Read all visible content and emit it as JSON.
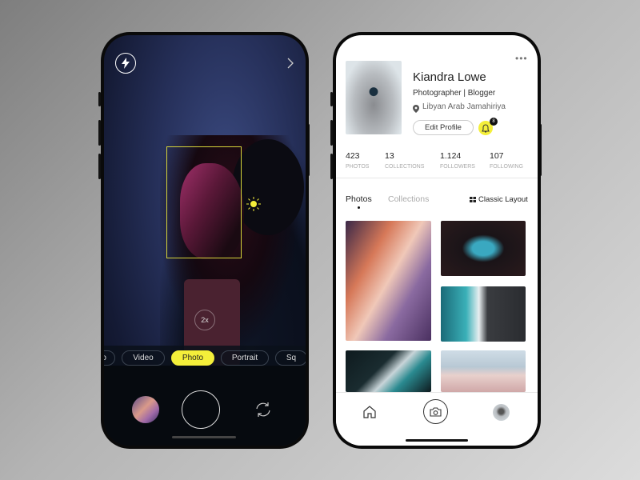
{
  "camera": {
    "zoom_label": "2x",
    "modes": [
      {
        "label": "Mo"
      },
      {
        "label": "Video"
      },
      {
        "label": "Photo",
        "active": true
      },
      {
        "label": "Portrait"
      },
      {
        "label": "Sq"
      }
    ],
    "icons": [
      "flash-icon",
      "chevron-right-icon",
      "sun-exposure-icon",
      "switch-camera-icon"
    ],
    "accent": "#f4ef3a"
  },
  "profile": {
    "name": "Kiandra Lowe",
    "bio": "Photographer | Blogger",
    "location": "Libyan Arab Jamahiriya",
    "edit_label": "Edit Profile",
    "notification_count": "8",
    "stats": [
      {
        "value": "423",
        "label": "PHOTOS"
      },
      {
        "value": "13",
        "label": "COLLECTIONS"
      },
      {
        "value": "1.124",
        "label": "FOLLOWERS"
      },
      {
        "value": "107",
        "label": "FOLLOWING"
      }
    ],
    "tabs": [
      {
        "label": "Photos",
        "active": true
      },
      {
        "label": "Collections"
      }
    ],
    "layout_label": "Classic Layout"
  }
}
